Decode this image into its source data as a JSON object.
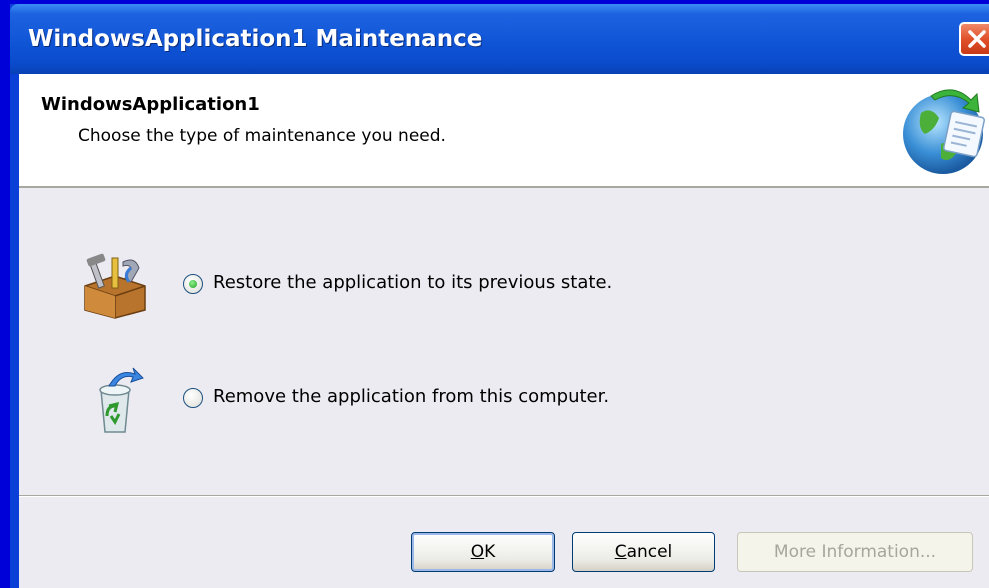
{
  "window": {
    "title": "WindowsApplication1 Maintenance"
  },
  "header": {
    "app_name": "WindowsApplication1",
    "subtitle": "Choose the type of maintenance you need."
  },
  "options": [
    {
      "label": "Restore the application to its previous state.",
      "checked": true,
      "icon": "toolbox-icon"
    },
    {
      "label": "Remove the application from this computer.",
      "checked": false,
      "icon": "recycle-bin-icon"
    }
  ],
  "buttons": {
    "ok": {
      "mnemonic": "O",
      "rest": "K"
    },
    "cancel": {
      "mnemonic": "C",
      "rest": "ancel"
    },
    "more_info": "More Information..."
  },
  "colors": {
    "titlebar": "#0f55d6",
    "client_bg": "#ecebf2",
    "close_button": "#e0502a"
  }
}
